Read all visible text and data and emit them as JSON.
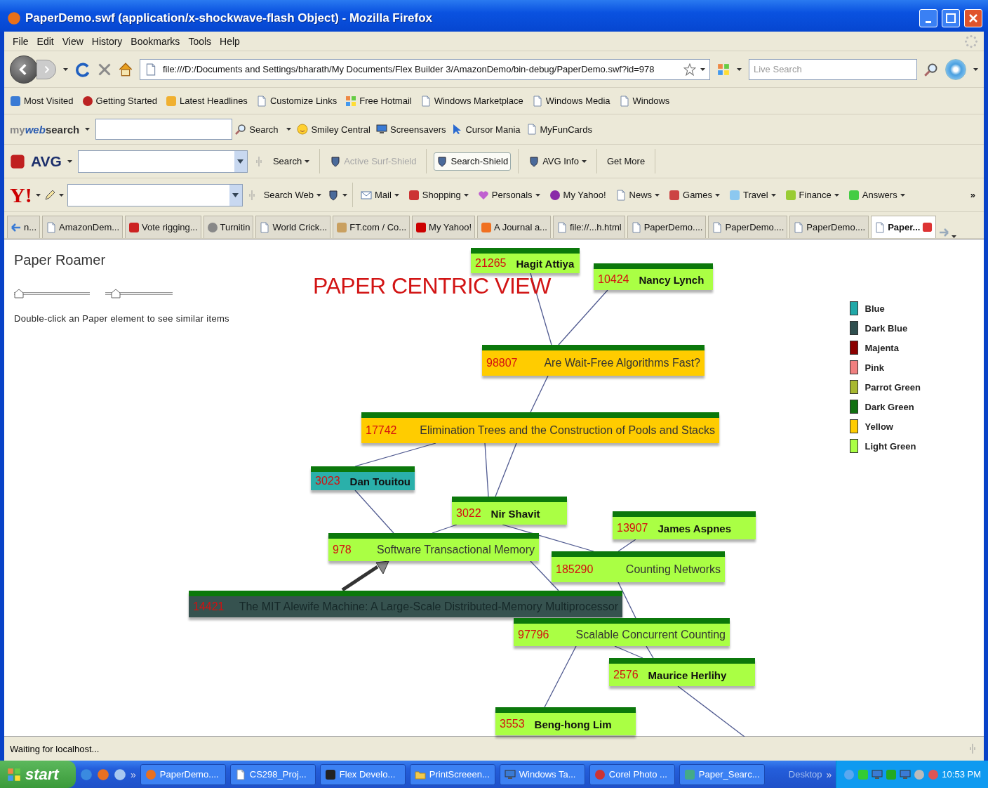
{
  "window": {
    "title": "PaperDemo.swf (application/x-shockwave-flash Object) - Mozilla Firefox"
  },
  "menu": [
    "File",
    "Edit",
    "View",
    "History",
    "Bookmarks",
    "Tools",
    "Help"
  ],
  "navigation": {
    "address": "file:///D:/Documents and Settings/bharath/My Documents/Flex Builder 3/AmazonDemo/bin-debug/PaperDemo.swf?id=978",
    "search_placeholder": "Live Search"
  },
  "bookmarks": [
    "Most Visited",
    "Getting Started",
    "Latest Headlines",
    "Customize Links",
    "Free Hotmail",
    "Windows Marketplace",
    "Windows Media",
    "Windows"
  ],
  "mywebsearch_toolbar": {
    "brand": [
      "my",
      "web",
      "search"
    ],
    "search_button": "Search",
    "links": [
      "Smiley Central",
      "Screensavers",
      "Cursor Mania",
      "MyFunCards"
    ]
  },
  "avg_toolbar": {
    "logo": "AVG",
    "items": [
      {
        "label": "Search",
        "kind": "text",
        "dropdown": true,
        "disabled": false,
        "selected": false
      },
      {
        "label": "Active Surf-Shield",
        "kind": "icon",
        "dropdown": false,
        "disabled": true,
        "selected": false
      },
      {
        "label": "Search-Shield",
        "kind": "icon",
        "dropdown": false,
        "disabled": false,
        "selected": true
      },
      {
        "label": "AVG Info",
        "kind": "icon",
        "dropdown": true,
        "disabled": false,
        "selected": false
      },
      {
        "label": "Get More",
        "kind": "text",
        "dropdown": false,
        "disabled": false,
        "selected": false
      }
    ]
  },
  "yahoo_toolbar": {
    "logo": "Y!",
    "search_button": "Search Web",
    "overflow": "»",
    "items": [
      {
        "label": "Mail",
        "dropdown": true
      },
      {
        "label": "Shopping",
        "dropdown": true
      },
      {
        "label": "Personals",
        "dropdown": true
      },
      {
        "label": "My Yahoo!",
        "dropdown": false
      },
      {
        "label": "News",
        "dropdown": true
      },
      {
        "label": "Games",
        "dropdown": true
      },
      {
        "label": "Travel",
        "dropdown": true
      },
      {
        "label": "Finance",
        "dropdown": true
      },
      {
        "label": "Answers",
        "dropdown": true
      }
    ]
  },
  "tabs": [
    {
      "label": "n...",
      "selected": false
    },
    {
      "label": "AmazonDem...",
      "selected": false
    },
    {
      "label": "Vote rigging...",
      "selected": false
    },
    {
      "label": "Turnitin",
      "selected": false
    },
    {
      "label": "World Crick...",
      "selected": false
    },
    {
      "label": "FT.com / Co...",
      "selected": false
    },
    {
      "label": "My Yahoo!",
      "selected": false
    },
    {
      "label": "A Journal a...",
      "selected": false
    },
    {
      "label": "file://...h.html",
      "selected": false
    },
    {
      "label": "PaperDemo....",
      "selected": false
    },
    {
      "label": "PaperDemo....",
      "selected": false
    },
    {
      "label": "PaperDemo....",
      "selected": false
    },
    {
      "label": "Paper...",
      "selected": true
    }
  ],
  "paper_roamer": {
    "title": "Paper Roamer",
    "sliders": [
      {
        "level": 0
      },
      {
        "level": 0.1
      }
    ],
    "hint": "Double-click an Paper element to see similar items"
  },
  "graph": {
    "title": "PAPER CENTRIC VIEW",
    "nodes": [
      {
        "id": "21265",
        "label": "Hagit Attiya",
        "kind": "author",
        "color": "#aaff44"
      },
      {
        "id": "10424",
        "label": "Nancy Lynch",
        "kind": "author",
        "color": "#aaff44"
      },
      {
        "id": "98807",
        "label": "Are Wait-Free Algorithms Fast?",
        "kind": "paper",
        "color": "#ffcc00"
      },
      {
        "id": "17742",
        "label": "Elimination Trees and the Construction of Pools and Stacks",
        "kind": "paper",
        "color": "#ffcc00"
      },
      {
        "id": "3023",
        "label": "Dan Touitou",
        "kind": "author",
        "color": "#2ab0aa"
      },
      {
        "id": "3022",
        "label": "Nir Shavit",
        "kind": "author",
        "color": "#aaff44"
      },
      {
        "id": "13907",
        "label": "James Aspnes",
        "kind": "author",
        "color": "#aaff44"
      },
      {
        "id": "978",
        "label": "Software Transactional Memory",
        "kind": "paper",
        "color": "#aaff44"
      },
      {
        "id": "185290",
        "label": "Counting Networks",
        "kind": "paper",
        "color": "#aaff44"
      },
      {
        "id": "14421",
        "label": "The MIT Alewife Machine: A Large-Scale Distributed-Memory Multiprocessor",
        "kind": "paper",
        "color": "#36524f"
      },
      {
        "id": "97796",
        "label": "Scalable Concurrent Counting",
        "kind": "paper",
        "color": "#aaff44"
      },
      {
        "id": "2576",
        "label": "Maurice Herlihy",
        "kind": "author",
        "color": "#aaff44"
      },
      {
        "id": "3553",
        "label": "Beng-hong Lim",
        "kind": "author",
        "color": "#aaff44"
      }
    ]
  },
  "legend": [
    {
      "label": "Blue",
      "color": "#20a8a8"
    },
    {
      "label": "Dark Blue",
      "color": "#2f4f4f"
    },
    {
      "label": "Majenta",
      "color": "#8b0000"
    },
    {
      "label": "Pink",
      "color": "#f08080"
    },
    {
      "label": "Parrot Green",
      "color": "#a8b830"
    },
    {
      "label": "Dark Green",
      "color": "#107010"
    },
    {
      "label": "Yellow",
      "color": "#ffcc00"
    },
    {
      "label": "Light Green",
      "color": "#aaff44"
    }
  ],
  "status_bar": {
    "text": "Waiting for localhost..."
  },
  "taskbar": {
    "start": "start",
    "overflow": "»",
    "tasks": [
      "PaperDemo....",
      "CS298_Proj...",
      "Flex Develo...",
      "PrintScreeen...",
      "Windows Ta...",
      "Corel Photo ...",
      "Paper_Searc..."
    ],
    "desktop": "Desktop",
    "desktop_overflow": "»",
    "clock": "10:53 PM"
  }
}
